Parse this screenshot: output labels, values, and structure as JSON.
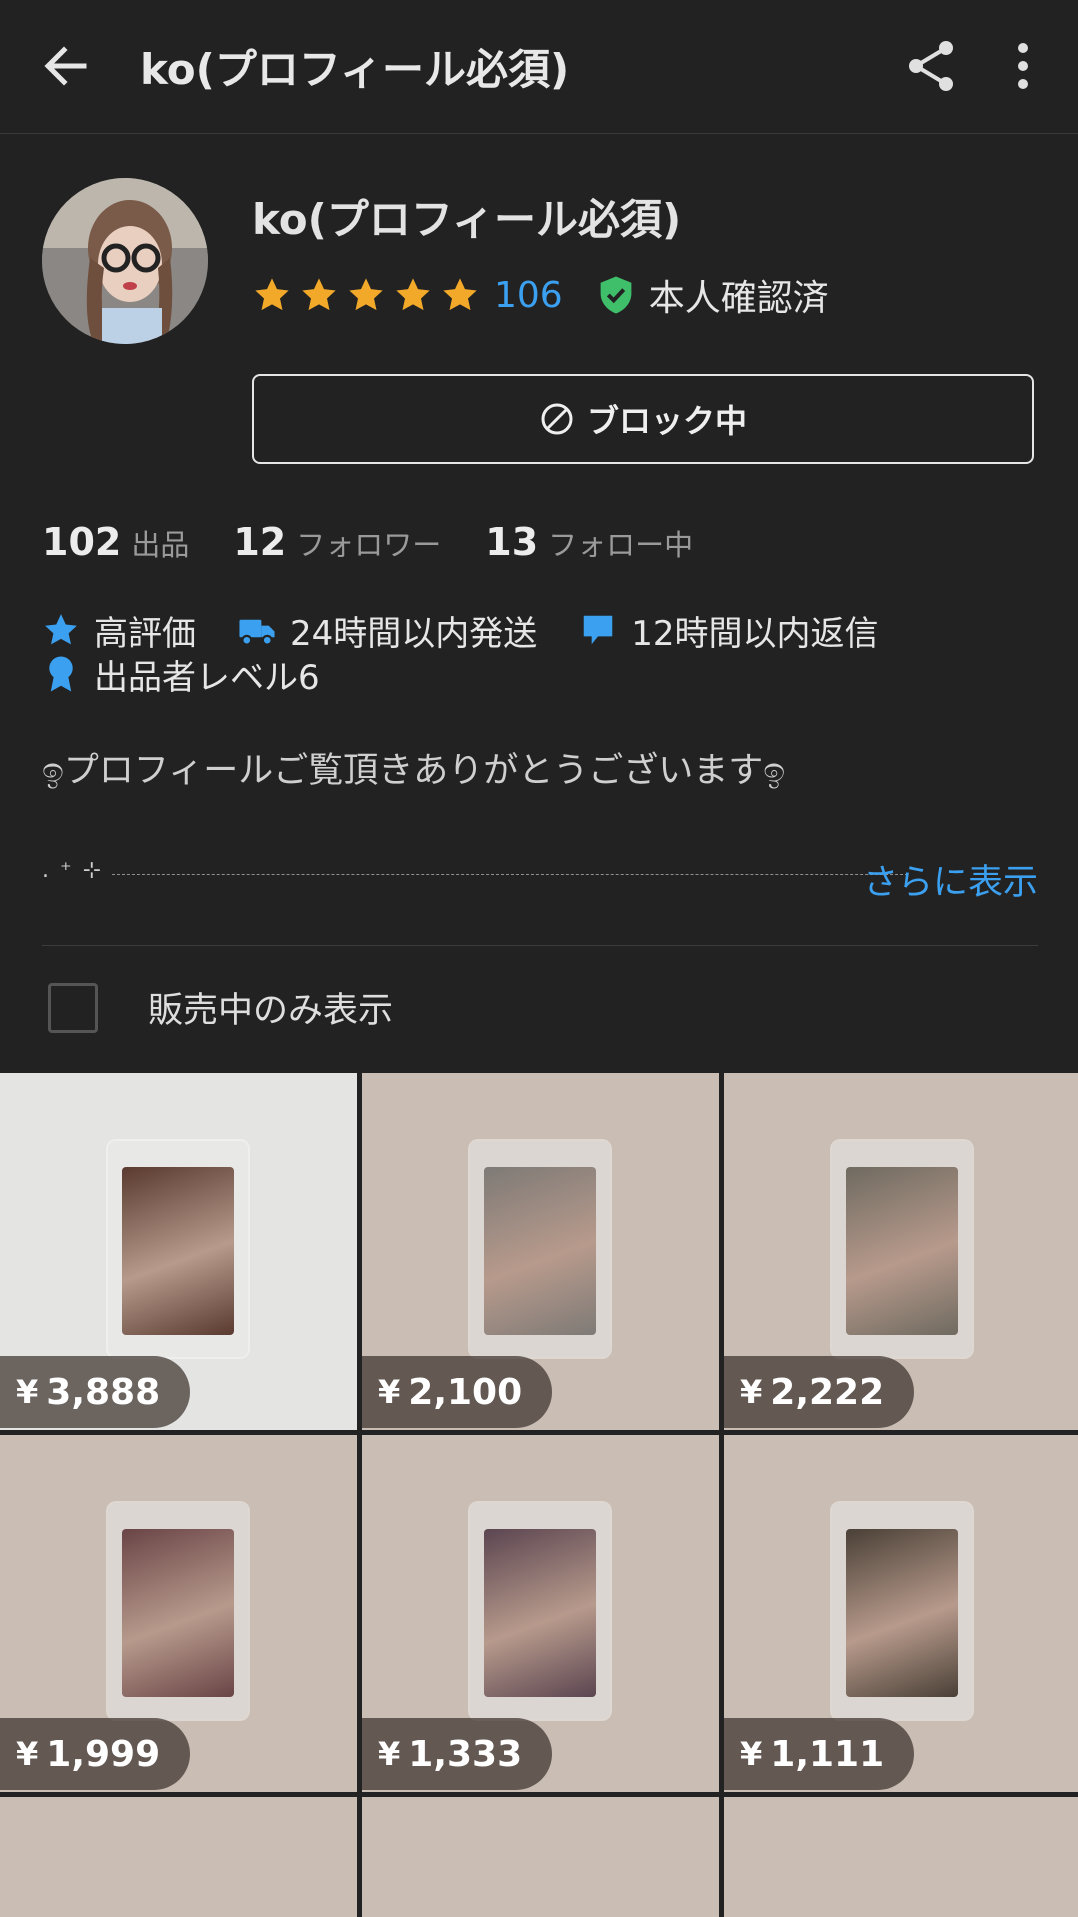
{
  "appbar": {
    "title": "ko(プロフィール必須)",
    "icons": [
      "back-arrow-icon",
      "share-icon",
      "more-vert-icon"
    ]
  },
  "profile": {
    "name": "ko(プロフィール必須)",
    "stars": 5,
    "rating_count": "106",
    "verified_label": "本人確認済",
    "block_button": "ブロック中"
  },
  "counts": [
    {
      "num": "102",
      "label": "出品"
    },
    {
      "num": "12",
      "label": "フォロワー"
    },
    {
      "num": "13",
      "label": "フォロー中"
    }
  ],
  "badges": [
    {
      "icon": "star-icon",
      "label": "高評価"
    },
    {
      "icon": "truck-icon",
      "label": "24時間以内発送"
    },
    {
      "icon": "chat-bubble-icon",
      "label": "12時間以内返信"
    },
    {
      "icon": "award-icon",
      "label": "出品者レベル6"
    }
  ],
  "bio": "ඉプロフィールご覧頂きありがとうございますඉ",
  "bio_second_line": ". ⁺ ⊹",
  "more_link": "さらに表示",
  "filter_label": "販売中のみ表示",
  "colors": {
    "background": "#222222",
    "accent_blue": "#3ba0f0",
    "star_gold": "#f2a829",
    "verified_green": "#3fbf6a"
  },
  "products": [
    {
      "price": "3,888",
      "bg": "white",
      "photo": "#5a3a30"
    },
    {
      "price": "2,100",
      "bg": "wood",
      "photo": "#7e7a76"
    },
    {
      "price": "2,222",
      "bg": "wood",
      "photo": "#6f6a60"
    },
    {
      "price": "1,999",
      "bg": "wood",
      "photo": "#6a4446"
    },
    {
      "price": "1,333",
      "bg": "wood",
      "photo": "#5b4550"
    },
    {
      "price": "1,111",
      "bg": "wood",
      "photo": "#4a4036"
    }
  ],
  "currency_symbol": "¥"
}
